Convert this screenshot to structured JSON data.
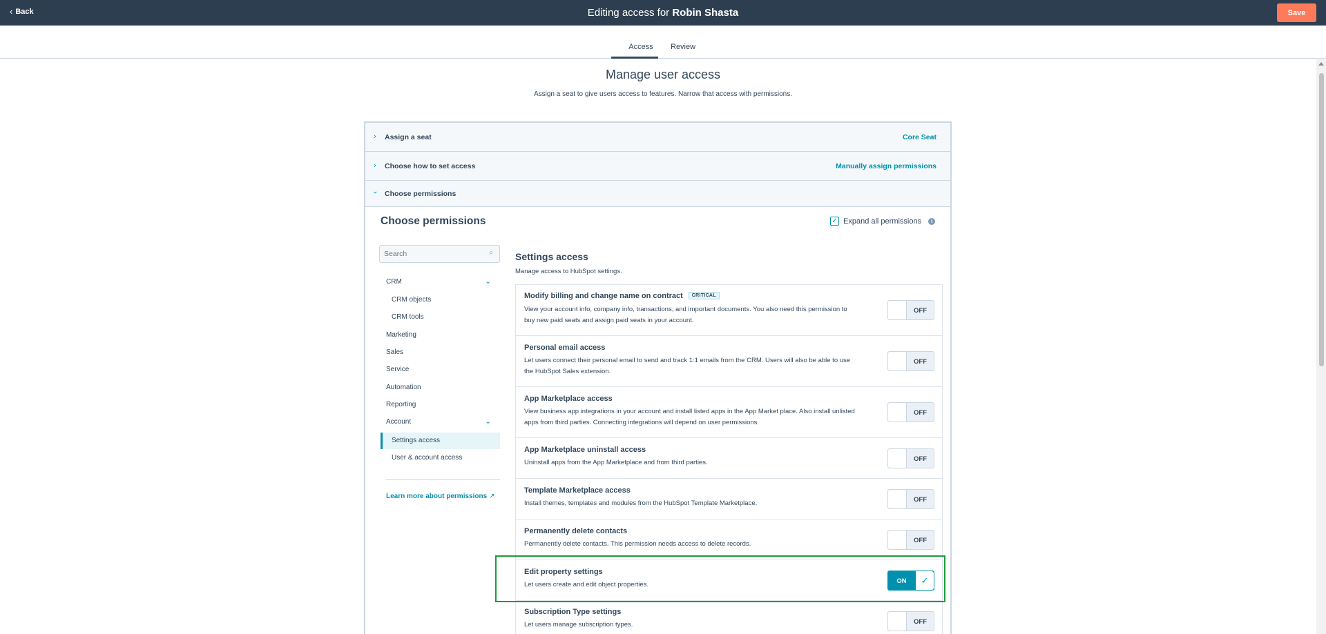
{
  "topbar": {
    "back_label": "Back",
    "title_prefix": "Editing access for ",
    "title_name": "Robin Shasta",
    "save_label": "Save"
  },
  "tabs": [
    {
      "label": "Access",
      "active": true
    },
    {
      "label": "Review",
      "active": false
    }
  ],
  "main": {
    "title": "Manage user access",
    "subtitle": "Assign a seat to give users access to features. Narrow that access with permissions."
  },
  "accordion": [
    {
      "label": "Assign a seat",
      "value": "Core Seat",
      "expanded": false
    },
    {
      "label": "Choose how to set access",
      "value": "Manually assign permissions",
      "expanded": false
    },
    {
      "label": "Choose permissions",
      "value": "",
      "expanded": true
    }
  ],
  "permissions": {
    "title": "Choose permissions",
    "expand_all_label": "Expand all permissions",
    "expand_all_checked": true,
    "search_placeholder": "Search",
    "nav": {
      "crm": "CRM",
      "crm_objects": "CRM objects",
      "crm_tools": "CRM tools",
      "marketing": "Marketing",
      "sales": "Sales",
      "service": "Service",
      "automation": "Automation",
      "reporting": "Reporting",
      "account": "Account",
      "settings_access": "Settings access",
      "user_account_access": "User & account access",
      "learn_more": "Learn more about permissions"
    },
    "section_title": "Settings access",
    "section_subtitle": "Manage access to HubSpot settings.",
    "items": [
      {
        "title": "Modify billing and change name on contract",
        "badge": "CRITICAL",
        "desc": "View your account info, company info, transactions, and important documents. You also need this permission to buy new paid seats and assign paid seats in your account.",
        "state": "OFF"
      },
      {
        "title": "Personal email access",
        "badge": "",
        "desc": "Let users connect their personal email to send and track 1:1 emails from the CRM. Users will also be able to use the HubSpot Sales extension.",
        "state": "OFF"
      },
      {
        "title": "App Marketplace access",
        "badge": "",
        "desc": "View business app integrations in your account and install listed apps in the App Market place. Also install unlisted apps from third parties. Connecting integrations will depend on user permissions.",
        "state": "OFF"
      },
      {
        "title": "App Marketplace uninstall access",
        "badge": "",
        "desc": "Uninstall apps from the App Marketplace and from third parties.",
        "state": "OFF"
      },
      {
        "title": "Template Marketplace access",
        "badge": "",
        "desc": "Install themes, templates and modules from the HubSpot Template Marketplace.",
        "state": "OFF"
      },
      {
        "title": "Permanently delete contacts",
        "badge": "",
        "desc": "Permanently delete contacts. This permission needs access to delete records.",
        "state": "OFF"
      },
      {
        "title": "Edit property settings",
        "badge": "",
        "desc": "Let users create and edit object properties.",
        "state": "ON"
      },
      {
        "title": "Subscription Type settings",
        "badge": "",
        "desc": "Let users manage subscription types.",
        "state": "OFF"
      }
    ]
  },
  "colors": {
    "header_bg": "#2d3e50",
    "save_btn": "#ff7a59",
    "accent": "#0091ae",
    "highlight": "#1a9d3b"
  }
}
